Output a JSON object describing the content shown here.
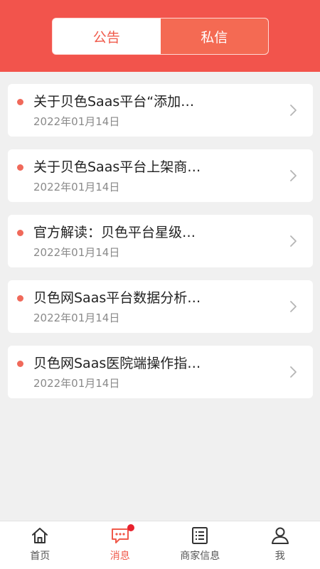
{
  "segment": {
    "tabs": [
      {
        "label": "公告",
        "active": false
      },
      {
        "label": "私信",
        "active": true
      }
    ]
  },
  "messages": [
    {
      "title": "关于贝色Saas平台“添加…",
      "date": "2022年01月14日"
    },
    {
      "title": "关于贝色Saas平台上架商…",
      "date": "2022年01月14日"
    },
    {
      "title": "官方解读：贝色平台星级…",
      "date": "2022年01月14日"
    },
    {
      "title": "贝色网Saas平台数据分析…",
      "date": "2022年01月14日"
    },
    {
      "title": "贝色网Saas医院端操作指…",
      "date": "2022年01月14日"
    }
  ],
  "tabbar": {
    "items": [
      {
        "label": "首页",
        "icon": "home-icon"
      },
      {
        "label": "消息",
        "icon": "chat-icon",
        "active": true,
        "badge": true
      },
      {
        "label": "商家信息",
        "icon": "list-icon"
      },
      {
        "label": "我",
        "icon": "user-icon"
      }
    ]
  },
  "colors": {
    "header": "#f2544c",
    "accent": "#f05a4b",
    "badge": "#e8212d"
  }
}
